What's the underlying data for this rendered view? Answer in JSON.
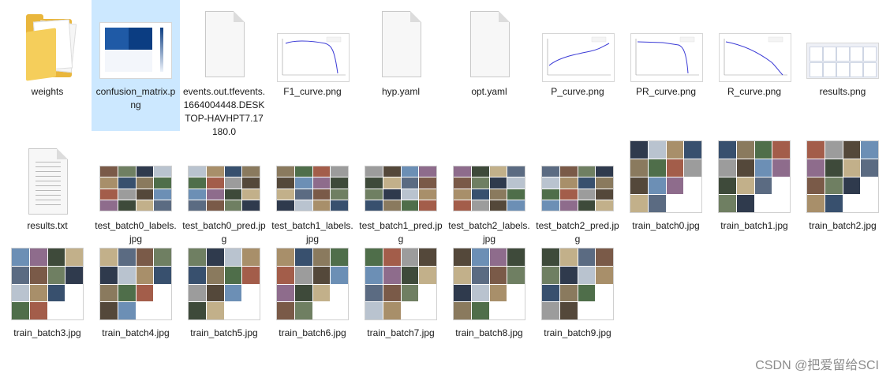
{
  "files": [
    {
      "name": "weights",
      "type": "folder",
      "selected": false
    },
    {
      "name": "confusion_matrix.png",
      "type": "confusion",
      "selected": true
    },
    {
      "name": "events.out.tfevents.1664004448.DESKTOP-HAVHPT7.17180.0",
      "type": "blank",
      "selected": false
    },
    {
      "name": "F1_curve.png",
      "type": "f1",
      "selected": false
    },
    {
      "name": "hyp.yaml",
      "type": "blank",
      "selected": false
    },
    {
      "name": "opt.yaml",
      "type": "blank",
      "selected": false
    },
    {
      "name": "P_curve.png",
      "type": "p",
      "selected": false
    },
    {
      "name": "PR_curve.png",
      "type": "pr",
      "selected": false
    },
    {
      "name": "R_curve.png",
      "type": "r",
      "selected": false
    },
    {
      "name": "results.png",
      "type": "results",
      "selected": false
    },
    {
      "name": "results.txt",
      "type": "text",
      "selected": false
    },
    {
      "name": "test_batch0_labels.jpg",
      "type": "test",
      "selected": false
    },
    {
      "name": "test_batch0_pred.jpg",
      "type": "test",
      "selected": false
    },
    {
      "name": "test_batch1_labels.jpg",
      "type": "test",
      "selected": false
    },
    {
      "name": "test_batch1_pred.jpg",
      "type": "test",
      "selected": false
    },
    {
      "name": "test_batch2_labels.jpg",
      "type": "test",
      "selected": false
    },
    {
      "name": "test_batch2_pred.jpg",
      "type": "test",
      "selected": false
    },
    {
      "name": "train_batch0.jpg",
      "type": "train",
      "selected": false
    },
    {
      "name": "train_batch1.jpg",
      "type": "train",
      "selected": false
    },
    {
      "name": "train_batch2.jpg",
      "type": "train",
      "selected": false
    },
    {
      "name": "train_batch3.jpg",
      "type": "train",
      "selected": false
    },
    {
      "name": "train_batch4.jpg",
      "type": "train",
      "selected": false
    },
    {
      "name": "train_batch5.jpg",
      "type": "train",
      "selected": false
    },
    {
      "name": "train_batch6.jpg",
      "type": "train",
      "selected": false
    },
    {
      "name": "train_batch7.jpg",
      "type": "train",
      "selected": false
    },
    {
      "name": "train_batch8.jpg",
      "type": "train",
      "selected": false
    },
    {
      "name": "train_batch9.jpg",
      "type": "train",
      "selected": false
    }
  ],
  "watermark": "CSDN @把爱留给SCI",
  "colors": {
    "selection": "#cce8ff",
    "folder": "#e9b63c",
    "curve": "#3b3bd6"
  }
}
